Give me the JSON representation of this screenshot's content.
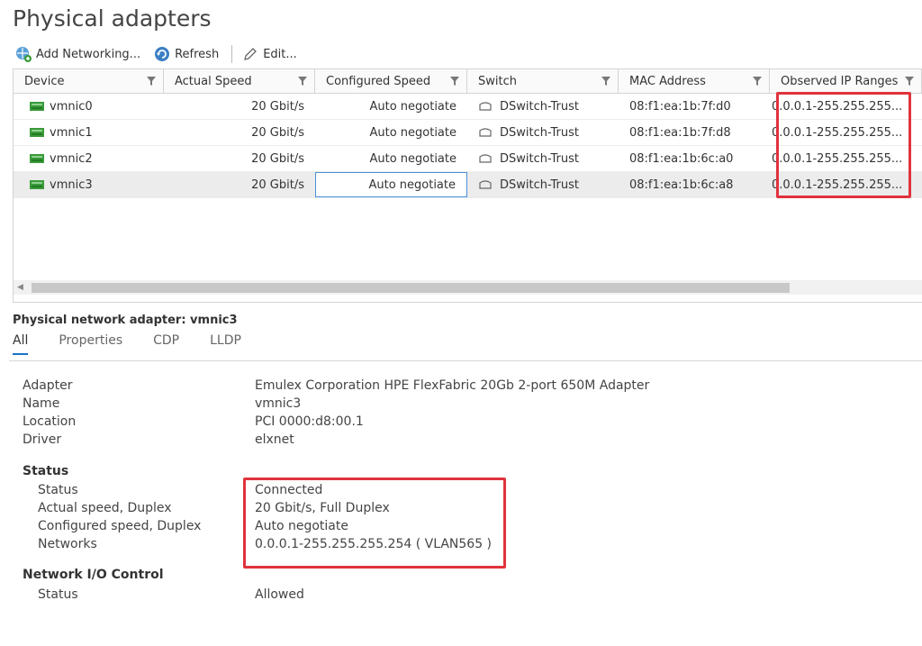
{
  "page_title": "Physical adapters",
  "toolbar": {
    "add_networking": "Add Networking...",
    "refresh": "Refresh",
    "edit": "Edit..."
  },
  "table": {
    "columns": [
      "Device",
      "Actual Speed",
      "Configured Speed",
      "Switch",
      "MAC Address",
      "Observed IP Ranges"
    ],
    "rows": [
      {
        "device": "vmnic0",
        "actual_speed": "20 Gbit/s",
        "configured_speed": "Auto negotiate",
        "switch": "DSwitch-Trust",
        "mac": "08:f1:ea:1b:7f:d0",
        "ip_ranges": "0.0.0.1-255.255.255..."
      },
      {
        "device": "vmnic1",
        "actual_speed": "20 Gbit/s",
        "configured_speed": "Auto negotiate",
        "switch": "DSwitch-Trust",
        "mac": "08:f1:ea:1b:7f:d8",
        "ip_ranges": "0.0.0.1-255.255.255..."
      },
      {
        "device": "vmnic2",
        "actual_speed": "20 Gbit/s",
        "configured_speed": "Auto negotiate",
        "switch": "DSwitch-Trust",
        "mac": "08:f1:ea:1b:6c:a0",
        "ip_ranges": "0.0.0.1-255.255.255..."
      },
      {
        "device": "vmnic3",
        "actual_speed": "20 Gbit/s",
        "configured_speed": "Auto negotiate",
        "switch": "DSwitch-Trust",
        "mac": "08:f1:ea:1b:6c:a8",
        "ip_ranges": "0.0.0.1-255.255.255..."
      }
    ],
    "selected_row": 3
  },
  "detail": {
    "title": "Physical network adapter: vmnic3",
    "tabs": [
      "All",
      "Properties",
      "CDP",
      "LLDP"
    ],
    "active_tab": "All",
    "adapter_label": "Adapter",
    "adapter_value": "Emulex Corporation HPE FlexFabric 20Gb 2-port 650M Adapter",
    "name_label": "Name",
    "name_value": "vmnic3",
    "location_label": "Location",
    "location_value": "PCI 0000:d8:00.1",
    "driver_label": "Driver",
    "driver_value": "elxnet",
    "status_section": "Status",
    "status_label": "Status",
    "status_value": "Connected",
    "actual_label": "Actual speed, Duplex",
    "actual_value": "20 Gbit/s, Full Duplex",
    "configured_label": "Configured speed, Duplex",
    "configured_value": "Auto negotiate",
    "networks_label": "Networks",
    "networks_value": "0.0.0.1-255.255.255.254 ( VLAN565 )",
    "nioc_section": "Network I/O Control",
    "nioc_status_label": "Status",
    "nioc_status_value": "Allowed"
  },
  "colors": {
    "highlight_box": "#e0333d",
    "nic_icon": "#3a9a3a",
    "tab_active": "#1a73c9"
  }
}
